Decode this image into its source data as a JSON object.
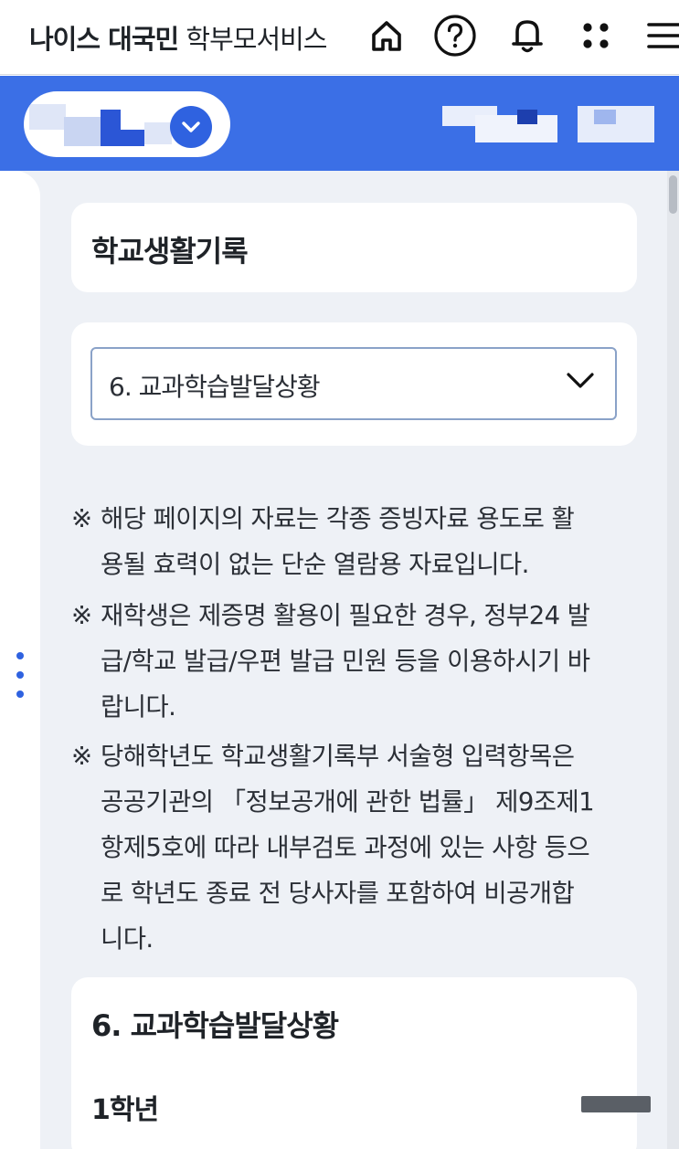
{
  "header": {
    "brand": "나이스 대국민",
    "service": "학부모서비스",
    "icons": [
      "home-icon",
      "help-icon",
      "bell-icon",
      "apps-icon",
      "menu-icon"
    ]
  },
  "colors": {
    "accent": "#3b6fe6",
    "background": "#eef1f6",
    "card": "#ffffff"
  },
  "page": {
    "title": "학교생활기록",
    "select": {
      "value": "6. 교과학습발달상황"
    },
    "notices": [
      {
        "mark": "※",
        "lines": [
          "해당 페이지의 자료는 각종 증빙자료 용도로 활",
          "용될 효력이 없는 단순 열람용 자료입니다."
        ]
      },
      {
        "mark": "※",
        "lines": [
          "재학생은 제증명 활용이 필요한 경우, 정부24 발",
          "급/학교 발급/우편 발급 민원 등을 이용하시기 바",
          "랍니다."
        ]
      },
      {
        "mark": "※",
        "lines": [
          "당해학년도 학교생활기록부 서술형 입력항목은",
          "공공기관의 「정보공개에 관한 법률」 제9조제1",
          "항제5호에 따라 내부검토 과정에 있는 사항 등으",
          "로 학년도 종료 전 당사자를 포함하여 비공개합",
          "니다."
        ]
      }
    ],
    "section_title": "6. 교과학습발달상황",
    "grade_title": "1학년"
  }
}
